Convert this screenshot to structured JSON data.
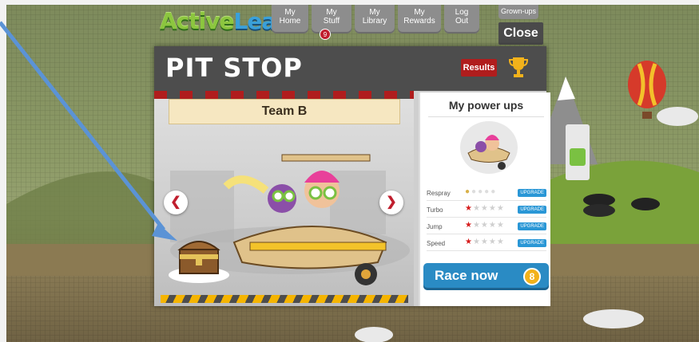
{
  "app": {
    "logo_part1": "Active",
    "logo_part2": "Learn"
  },
  "nav": {
    "items": [
      {
        "line1": "My",
        "line2": "Home"
      },
      {
        "line1": "My",
        "line2": "Stuff"
      },
      {
        "line1": "My",
        "line2": "Library"
      },
      {
        "line1": "My",
        "line2": "Rewards"
      },
      {
        "line1": "Log",
        "line2": "Out"
      }
    ],
    "stuff_badge": "9",
    "grownups": "Grown-ups",
    "close": "Close"
  },
  "modal": {
    "title": "PIT STOP",
    "results_label": "Results",
    "team_name": "Team B",
    "prev_icon": "chevron-left-icon",
    "next_icon": "chevron-right-icon"
  },
  "powerups": {
    "title": "My power ups",
    "rows": [
      {
        "label": "Respray",
        "upgrade": "UPGRADE"
      },
      {
        "label": "Turbo",
        "upgrade": "UPGRADE",
        "level": 1,
        "max": 5
      },
      {
        "label": "Jump",
        "upgrade": "UPGRADE",
        "level": 1,
        "max": 5
      },
      {
        "label": "Speed",
        "upgrade": "UPGRADE",
        "level": 1,
        "max": 5
      }
    ],
    "race_label": "Race now",
    "race_count": "8"
  },
  "colors": {
    "accent_blue": "#2a8bc4",
    "header_dark": "#4d4d4d",
    "results_red": "#b01d1d",
    "badge_orange": "#f2b21b"
  }
}
